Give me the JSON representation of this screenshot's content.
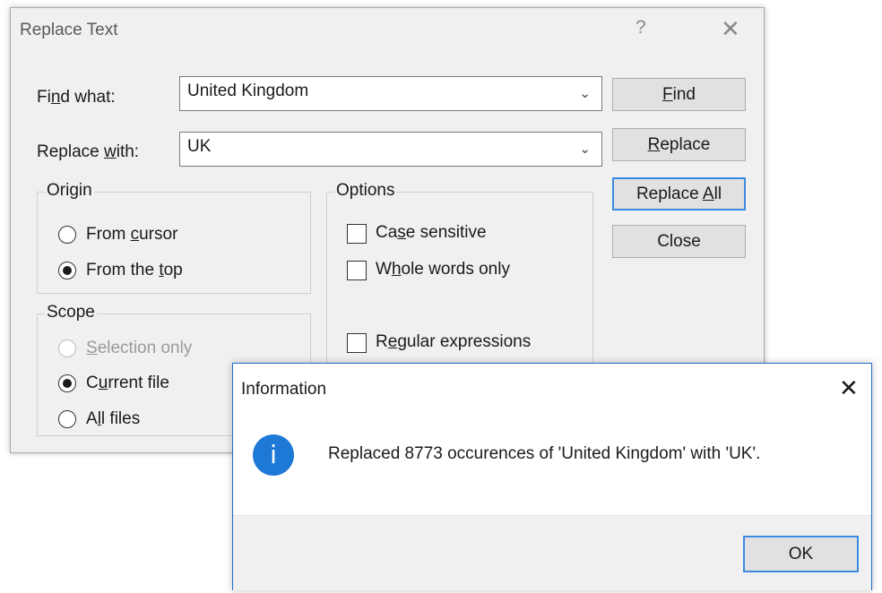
{
  "replace_dialog": {
    "title": "Replace Text",
    "help_glyph": "?",
    "close_glyph": "✕",
    "find_label_pre": "Fi",
    "find_label_key": "n",
    "find_label_post": "d what:",
    "find_value": "United Kingdom",
    "replace_label_pre": "Replace ",
    "replace_label_key": "w",
    "replace_label_post": "ith:",
    "replace_value": "UK",
    "buttons": {
      "find_key": "F",
      "find_rest": "ind",
      "replace_key": "R",
      "replace_rest": "eplace",
      "replace_all_pre": "Replace ",
      "replace_all_key": "A",
      "replace_all_post": "ll",
      "close": "Close"
    },
    "origin": {
      "caption": "Origin",
      "from_cursor_pre": "From ",
      "from_cursor_key": "c",
      "from_cursor_post": "ursor",
      "from_top_pre": "From the ",
      "from_top_key": "t",
      "from_top_post": "op",
      "selected": "From the top"
    },
    "scope": {
      "caption": "Scope",
      "selection_key": "S",
      "selection_rest": "election only",
      "current_pre": "C",
      "current_key": "u",
      "current_post": "rrent file",
      "all_pre": "A",
      "all_key": "l",
      "all_post": "l files",
      "selected": "Current file"
    },
    "options": {
      "caption": "Options",
      "case_pre": "Ca",
      "case_key": "s",
      "case_post": "e sensitive",
      "whole_pre": "W",
      "whole_key": "h",
      "whole_post": "ole words only",
      "regex_pre": "R",
      "regex_key": "e",
      "regex_post": "gular expressions",
      "case_checked": false,
      "whole_checked": false,
      "regex_checked": false
    }
  },
  "info_dialog": {
    "title": "Information",
    "close_glyph": "✕",
    "icon_glyph": "i",
    "message": "Replaced 8773 occurences of 'United Kingdom' with 'UK'.",
    "ok_label": "OK"
  },
  "colors": {
    "dialog_bg": "#f0f0f0",
    "accent_border": "#3c8ae0",
    "info_icon": "#1d78d6"
  }
}
